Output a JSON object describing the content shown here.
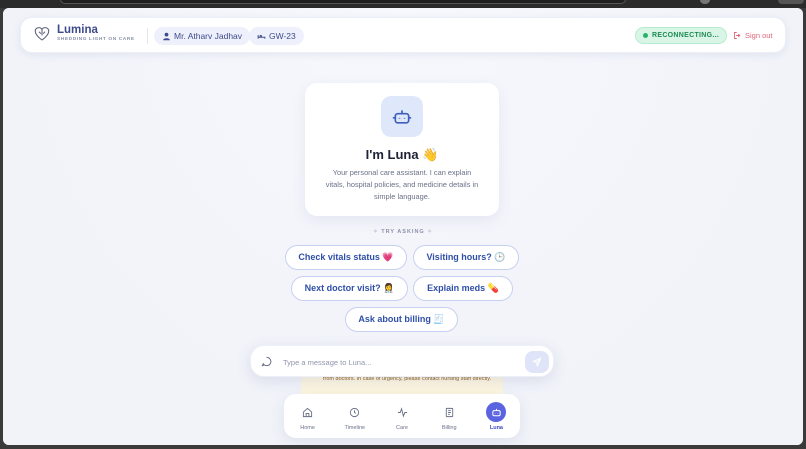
{
  "brand": {
    "name": "Lumina",
    "tagline": "SHEDDING LIGHT ON CARE"
  },
  "header": {
    "user_chip": "Mr. Atharv Jadhav",
    "ward_chip": "GW-23",
    "status": "RECONNECTING...",
    "signout": "Sign out"
  },
  "intro": {
    "title": "I'm Luna 👋",
    "description": "Your personal care assistant. I can explain vitals, hospital policies, and medicine details in simple language."
  },
  "try_asking": "TRY ASKING",
  "suggestions": [
    "Check vitals status 💗",
    "Visiting hours? 🕒",
    "Next doctor visit? 👩‍⚕️",
    "Explain meds 💊",
    "Ask about billing 🧾"
  ],
  "disclaimer": "from doctors. In case of urgency, please contact nursing staff directly.",
  "composer": {
    "placeholder": "Type a message to Luna..."
  },
  "nav": [
    {
      "label": "Home",
      "icon": "home-icon"
    },
    {
      "label": "Timeline",
      "icon": "clock-icon"
    },
    {
      "label": "Care",
      "icon": "pulse-icon"
    },
    {
      "label": "Billing",
      "icon": "receipt-icon"
    },
    {
      "label": "Luna",
      "icon": "bot-icon",
      "active": true
    }
  ],
  "colors": {
    "accent": "#5b63e0",
    "brand": "#3d4a8c",
    "status_bg": "#d9f5e6",
    "status_text": "#1f8a55",
    "signout": "#e0667a",
    "suggestion_text": "#2f4fa8"
  }
}
